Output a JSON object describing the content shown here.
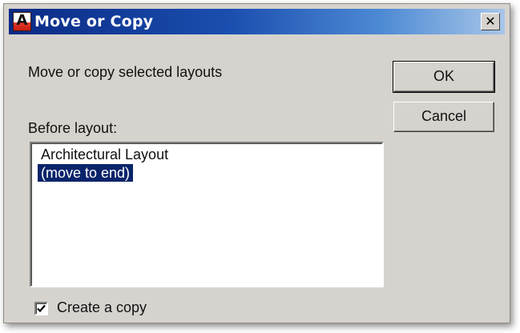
{
  "window": {
    "title": "Move or Copy",
    "app_icon": {
      "name": "autocad-icon",
      "glyph": "A"
    },
    "close_glyph": "✕"
  },
  "dialog": {
    "prompt": "Move or copy selected layouts",
    "before_layout_label": "Before layout:",
    "layouts": [
      {
        "label": "Architectural Layout",
        "selected": false
      },
      {
        "label": "(move to end)",
        "selected": true
      }
    ],
    "create_copy": {
      "label": "Create a copy",
      "checked": true
    }
  },
  "buttons": {
    "ok_label": "OK",
    "cancel_label": "Cancel"
  },
  "colors": {
    "titlebar_start": "#0a2a84",
    "titlebar_end": "#a8c6e8",
    "dialog_bg": "#d6d3ce",
    "selection_bg": "#0a246a"
  }
}
